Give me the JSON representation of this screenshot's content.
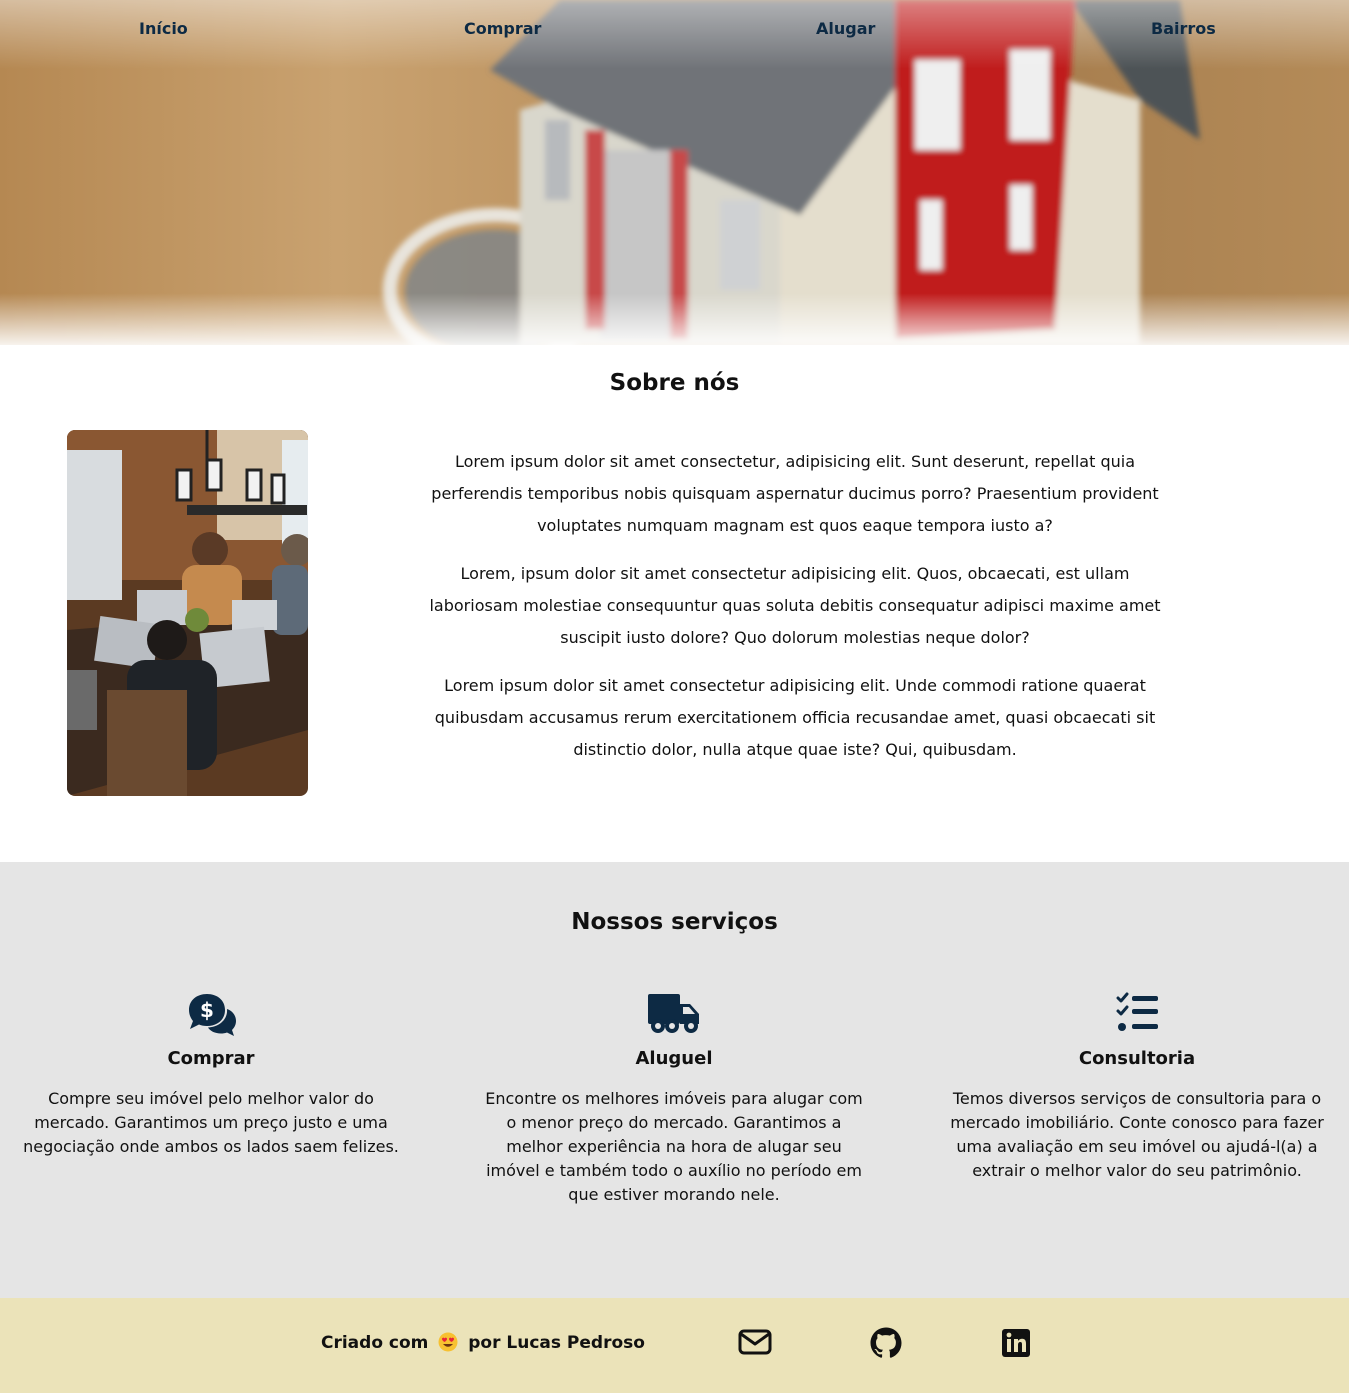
{
  "nav": {
    "items": [
      {
        "label": "Início"
      },
      {
        "label": "Comprar"
      },
      {
        "label": "Alugar"
      },
      {
        "label": "Bairros"
      }
    ]
  },
  "about": {
    "title": "Sobre nós",
    "paragraphs": [
      "Lorem ipsum dolor sit amet consectetur, adipisicing elit. Sunt deserunt, repellat quia perferendis temporibus nobis quisquam aspernatur ducimus porro? Praesentium provident voluptates numquam magnam est quos eaque tempora iusto a?",
      "Lorem, ipsum dolor sit amet consectetur adipisicing elit. Quos, obcaecati, est ullam laboriosam molestiae consequuntur quas soluta debitis consequatur adipisci maxime amet suscipit iusto dolore? Quo dolorum molestias neque dolor?",
      "Lorem ipsum dolor sit amet consectetur adipisicing elit. Unde commodi ratione quaerat quibusdam accusamus rerum exercitationem officia recusandae amet, quasi obcaecati sit distinctio dolor, nulla atque quae iste? Qui, quibusdam."
    ]
  },
  "services": {
    "title": "Nossos serviços",
    "items": [
      {
        "icon": "money-chat-icon",
        "title": "Comprar",
        "text": "Compre seu imóvel pelo melhor valor do mercado. Garantimos um preço justo e uma negociação onde ambos os lados saem felizes."
      },
      {
        "icon": "truck-icon",
        "title": "Aluguel",
        "text": "Encontre os melhores imóveis para alugar com o menor preço do mercado. Garantimos a melhor experiência na hora de alugar seu imóvel e também todo o auxílio no período em que estiver morando nele."
      },
      {
        "icon": "checklist-icon",
        "title": "Consultoria",
        "text": "Temos diversos serviços de consultoria para o mercado imobiliário. Conte conosco para fazer uma avaliação em seu imóvel ou ajudá-l(a) a extrair o melhor valor do seu patrimônio."
      }
    ]
  },
  "footer": {
    "credit_prefix": "Criado com",
    "credit_suffix": "por Lucas Pedroso",
    "icons": [
      "envelope-icon",
      "github-icon",
      "linkedin-icon"
    ]
  },
  "colors": {
    "nav_text": "#0d2a44",
    "icon": "#0d2a44",
    "services_bg": "#e5e5e5",
    "footer_bg": "#ebe3b9"
  }
}
